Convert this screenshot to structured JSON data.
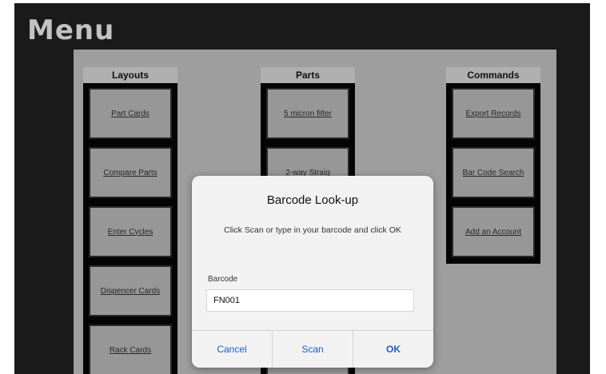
{
  "screen": {
    "title": "Menu"
  },
  "columns": {
    "layouts": {
      "header": "Layouts",
      "items": [
        "Part Cards",
        "Compare Parts",
        "Enter Cycles",
        "Dispencer Cards",
        "Rack Cards"
      ]
    },
    "parts": {
      "header": "Parts",
      "items": [
        "5 micron filter",
        "2-way Straig"
      ]
    },
    "commands": {
      "header": "Commands",
      "items": [
        "Export Records",
        "Bar Code Search",
        "Add an Account"
      ]
    }
  },
  "dialog": {
    "title": "Barcode Look-up",
    "message": "Click Scan or type in your barcode and click OK",
    "field_label": "Barcode",
    "field_value": "FN001",
    "buttons": {
      "cancel": "Cancel",
      "scan": "Scan",
      "ok": "OK"
    }
  },
  "colors": {
    "background": "#1c1c1c",
    "panel": "#a8a8a8",
    "tile": "#a1a1a1",
    "dialog_accent": "#1a5fd6"
  }
}
